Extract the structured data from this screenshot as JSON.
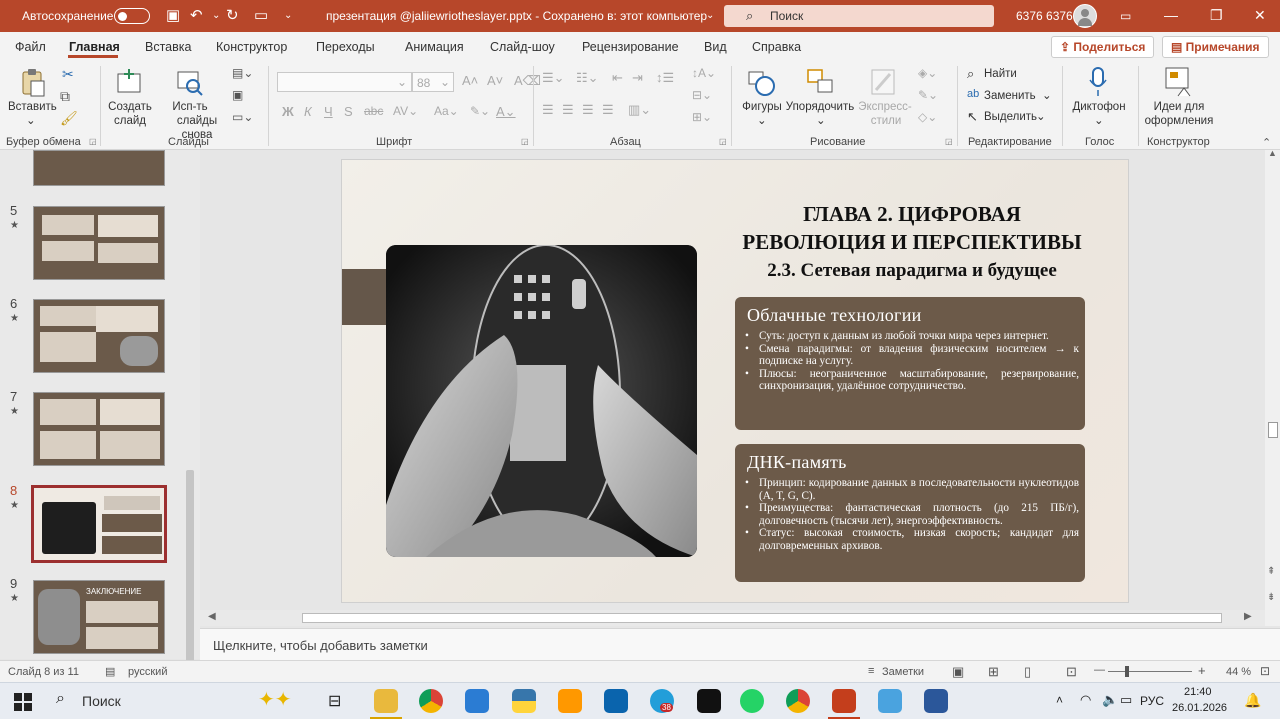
{
  "window": {
    "autosave_label": "Автосохранение",
    "title": "презентация @jaliiewriotheslayer.pptx - Сохранено в: этот компьютер",
    "search_placeholder": "Поиск",
    "user": "6376 6376"
  },
  "menu": [
    "Файл",
    "Главная",
    "Вставка",
    "Конструктор",
    "Переходы",
    "Анимация",
    "Слайд-шоу",
    "Рецензирование",
    "Вид",
    "Справка"
  ],
  "menu_buttons": {
    "share": "Поделиться",
    "comments": "Примечания"
  },
  "ribbon": {
    "paste": "Вставить",
    "create_slide_1": "Создать",
    "create_slide_2": "слайд",
    "reuse_1": "Исп-ть",
    "reuse_2": "слайды снова",
    "font_size": "88",
    "shapes": "Фигуры",
    "arrange": "Упорядочить",
    "styles_1": "Экспресс-",
    "styles_2": "стили",
    "find": "Найти",
    "replace": "Заменить",
    "select": "Выделить",
    "dictation": "Диктофон",
    "designer_1": "Идеи для",
    "designer_2": "оформления",
    "groups": [
      "Буфер обмена",
      "Слайды",
      "Шрифт",
      "Абзац",
      "Рисование",
      "Редактирование",
      "Голос",
      "Конструктор"
    ]
  },
  "thumbnails": [
    {
      "num": "5"
    },
    {
      "num": "6"
    },
    {
      "num": "7"
    },
    {
      "num": "8",
      "selected": true
    },
    {
      "num": "9",
      "title": "ЗАКЛЮЧЕНИЕ"
    }
  ],
  "slide": {
    "title_1": "ГЛАВА 2. ЦИФРОВАЯ",
    "title_2": "РЕВОЛЮЦИЯ И ПЕРСПЕКТИВЫ",
    "subtitle": "2.3. Сетевая парадигма и будущее",
    "card1": {
      "heading": "Облачные технологии",
      "items": [
        "Суть: доступ к данным из любой точки мира через интернет.",
        "Смена парадигмы: от владения физическим носителем → к подписке на услугу.",
        "Плюсы: неограниченное масштабирование, резервирование, синхронизация, удалённое сотрудничество."
      ]
    },
    "card2": {
      "heading": "ДНК-память",
      "items": [
        "Принцип: кодирование данных в последовательности нуклеотидов (A, T, G, C).",
        "Преимущества: фантастическая плотность (до 215 ПБ/г), долговечность (тысячи лет), энергоэффективность.",
        "Статус: высокая стоимость, низкая скорость; кандидат для долговременных архивов."
      ]
    }
  },
  "notes_placeholder": "Щелкните, чтобы добавить заметки",
  "status": {
    "slide": "Слайд 8 из 11",
    "lang": "русский",
    "notes": "Заметки",
    "zoom": "44 %"
  },
  "taskbar": {
    "search": "Поиск",
    "lang": "РУС",
    "time": "21:40",
    "date": "26.01.2026",
    "telegram_badge": "38"
  }
}
